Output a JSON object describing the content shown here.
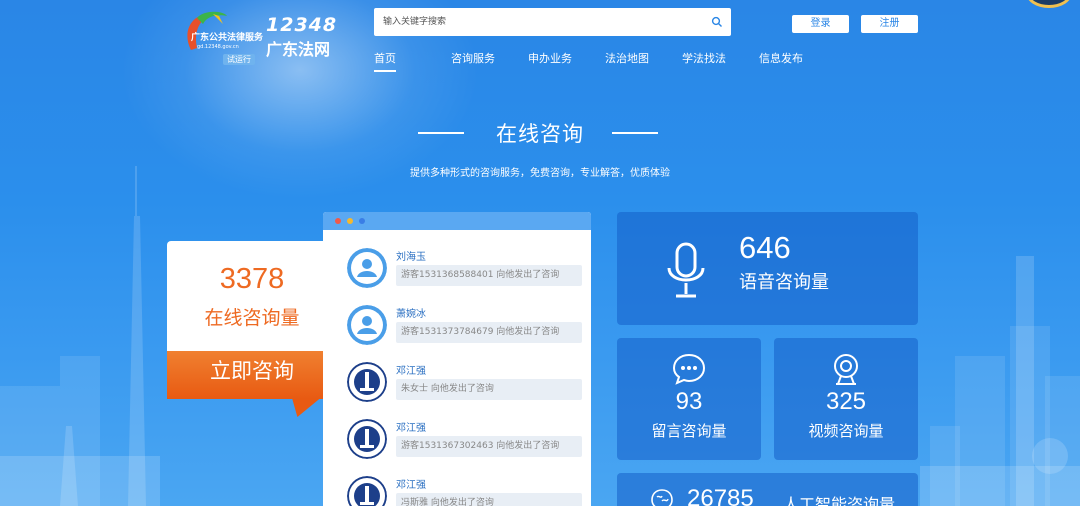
{
  "header": {
    "logo": {
      "org_name": "广东公共法律服务",
      "url_text": "gd.12348.gov.cn",
      "badge": "试运行",
      "hotline": "12348",
      "site_name": "广东法网"
    },
    "search": {
      "placeholder": "输入关键字搜索",
      "icon": "search-icon"
    },
    "login_label": "登录",
    "register_label": "注册",
    "nav": [
      {
        "label": "首页",
        "active": true
      },
      {
        "label": "咨询服务",
        "active": false
      },
      {
        "label": "申办业务",
        "active": false
      },
      {
        "label": "法治地图",
        "active": false
      },
      {
        "label": "学法找法",
        "active": false
      },
      {
        "label": "信息发布",
        "active": false
      }
    ]
  },
  "section": {
    "title": "在线咨询",
    "subtitle": "提供多种形式的咨询服务，免费咨询，专业解答，优质体验"
  },
  "online": {
    "count": "3378",
    "label": "在线咨询量",
    "button_label": "立即咨询"
  },
  "chat": {
    "dots": [
      "#f05a4a",
      "#f5b82e",
      "#3cc05a"
    ],
    "items": [
      {
        "name": "刘海玉",
        "message": "游客1531368588401 向他发出了咨询",
        "avatar": "user-icon"
      },
      {
        "name": "萧婉冰",
        "message": "游客1531373784679 向他发出了咨询",
        "avatar": "user-icon"
      },
      {
        "name": "邓江强",
        "message": "朱女士 向他发出了咨询",
        "avatar": "lawyer-badge-icon"
      },
      {
        "name": "邓江强",
        "message": "游客1531367302463 向他发出了咨询",
        "avatar": "lawyer-badge-icon"
      },
      {
        "name": "邓江强",
        "message": "冯斯雅 向他发出了咨询",
        "avatar": "lawyer-badge-icon"
      }
    ]
  },
  "stats": {
    "voice": {
      "value": "646",
      "label": "语音咨询量",
      "icon": "microphone-icon"
    },
    "message": {
      "value": "93",
      "label": "留言咨询量",
      "icon": "chat-bubble-icon"
    },
    "video": {
      "value": "325",
      "label": "视频咨询量",
      "icon": "webcam-icon"
    },
    "ai": {
      "value": "26785",
      "label": "人工智能咨询量",
      "icon": "brain-icon"
    }
  },
  "colors": {
    "accent_orange": "#ee6a22",
    "background_blue": "#2b8fec",
    "card_blue": "#1a66c8"
  }
}
